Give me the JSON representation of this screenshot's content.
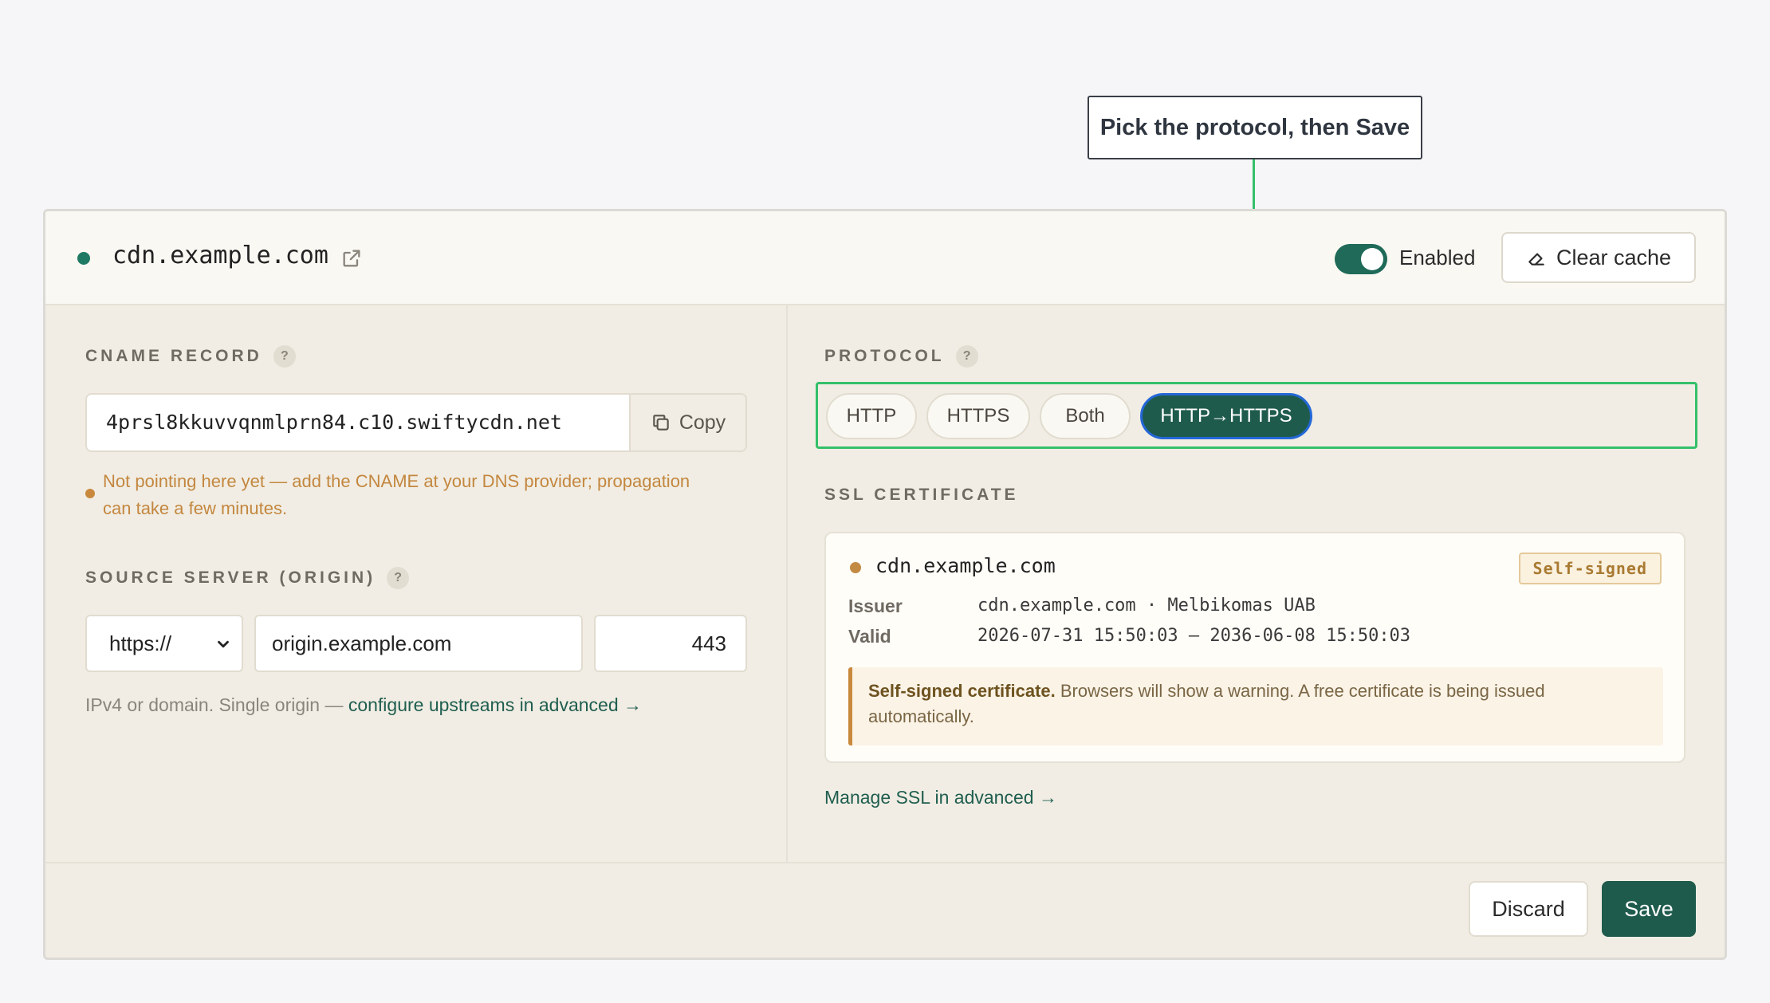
{
  "callout": {
    "text": "Pick the protocol, then Save"
  },
  "header": {
    "domain": "cdn.example.com",
    "toggle_label": "Enabled",
    "toggle_on": true,
    "clear_cache_label": "Clear cache"
  },
  "cname": {
    "label": "CNAME RECORD",
    "help": "?",
    "value": "4prsl8kkuvvqnmlprn84.c10.swiftycdn.net",
    "copy_label": "Copy",
    "warning": "Not pointing here yet — add the CNAME at your DNS provider; propagation can take a few minutes."
  },
  "origin": {
    "label": "SOURCE SERVER (ORIGIN)",
    "help": "?",
    "scheme": "https://",
    "host": "origin.example.com",
    "port": "443",
    "help_text": "IPv4 or domain. Single origin — ",
    "help_link": "configure upstreams in advanced →"
  },
  "protocol": {
    "label": "PROTOCOL",
    "help": "?",
    "options": [
      "HTTP",
      "HTTPS",
      "Both",
      "HTTP→HTTPS"
    ],
    "selected": "HTTP→HTTPS"
  },
  "ssl": {
    "label": "SSL CERTIFICATE",
    "domain": "cdn.example.com",
    "badge": "Self-signed",
    "issuer_key": "Issuer",
    "issuer_value": "cdn.example.com · Melbikomas UAB",
    "valid_key": "Valid",
    "valid_value": "2026-07-31 15:50:03 — 2036-06-08 15:50:03",
    "note_bold": "Self-signed certificate.",
    "note_text": " Browsers will show a warning. A free certificate is being issued automatically.",
    "manage_link": "Manage SSL in advanced →"
  },
  "footer": {
    "discard_label": "Discard",
    "save_label": "Save"
  },
  "colors": {
    "accent": "#1f5b4d",
    "highlight": "#34c06a",
    "warning": "#c9893d",
    "focus_ring": "#2468d8"
  }
}
